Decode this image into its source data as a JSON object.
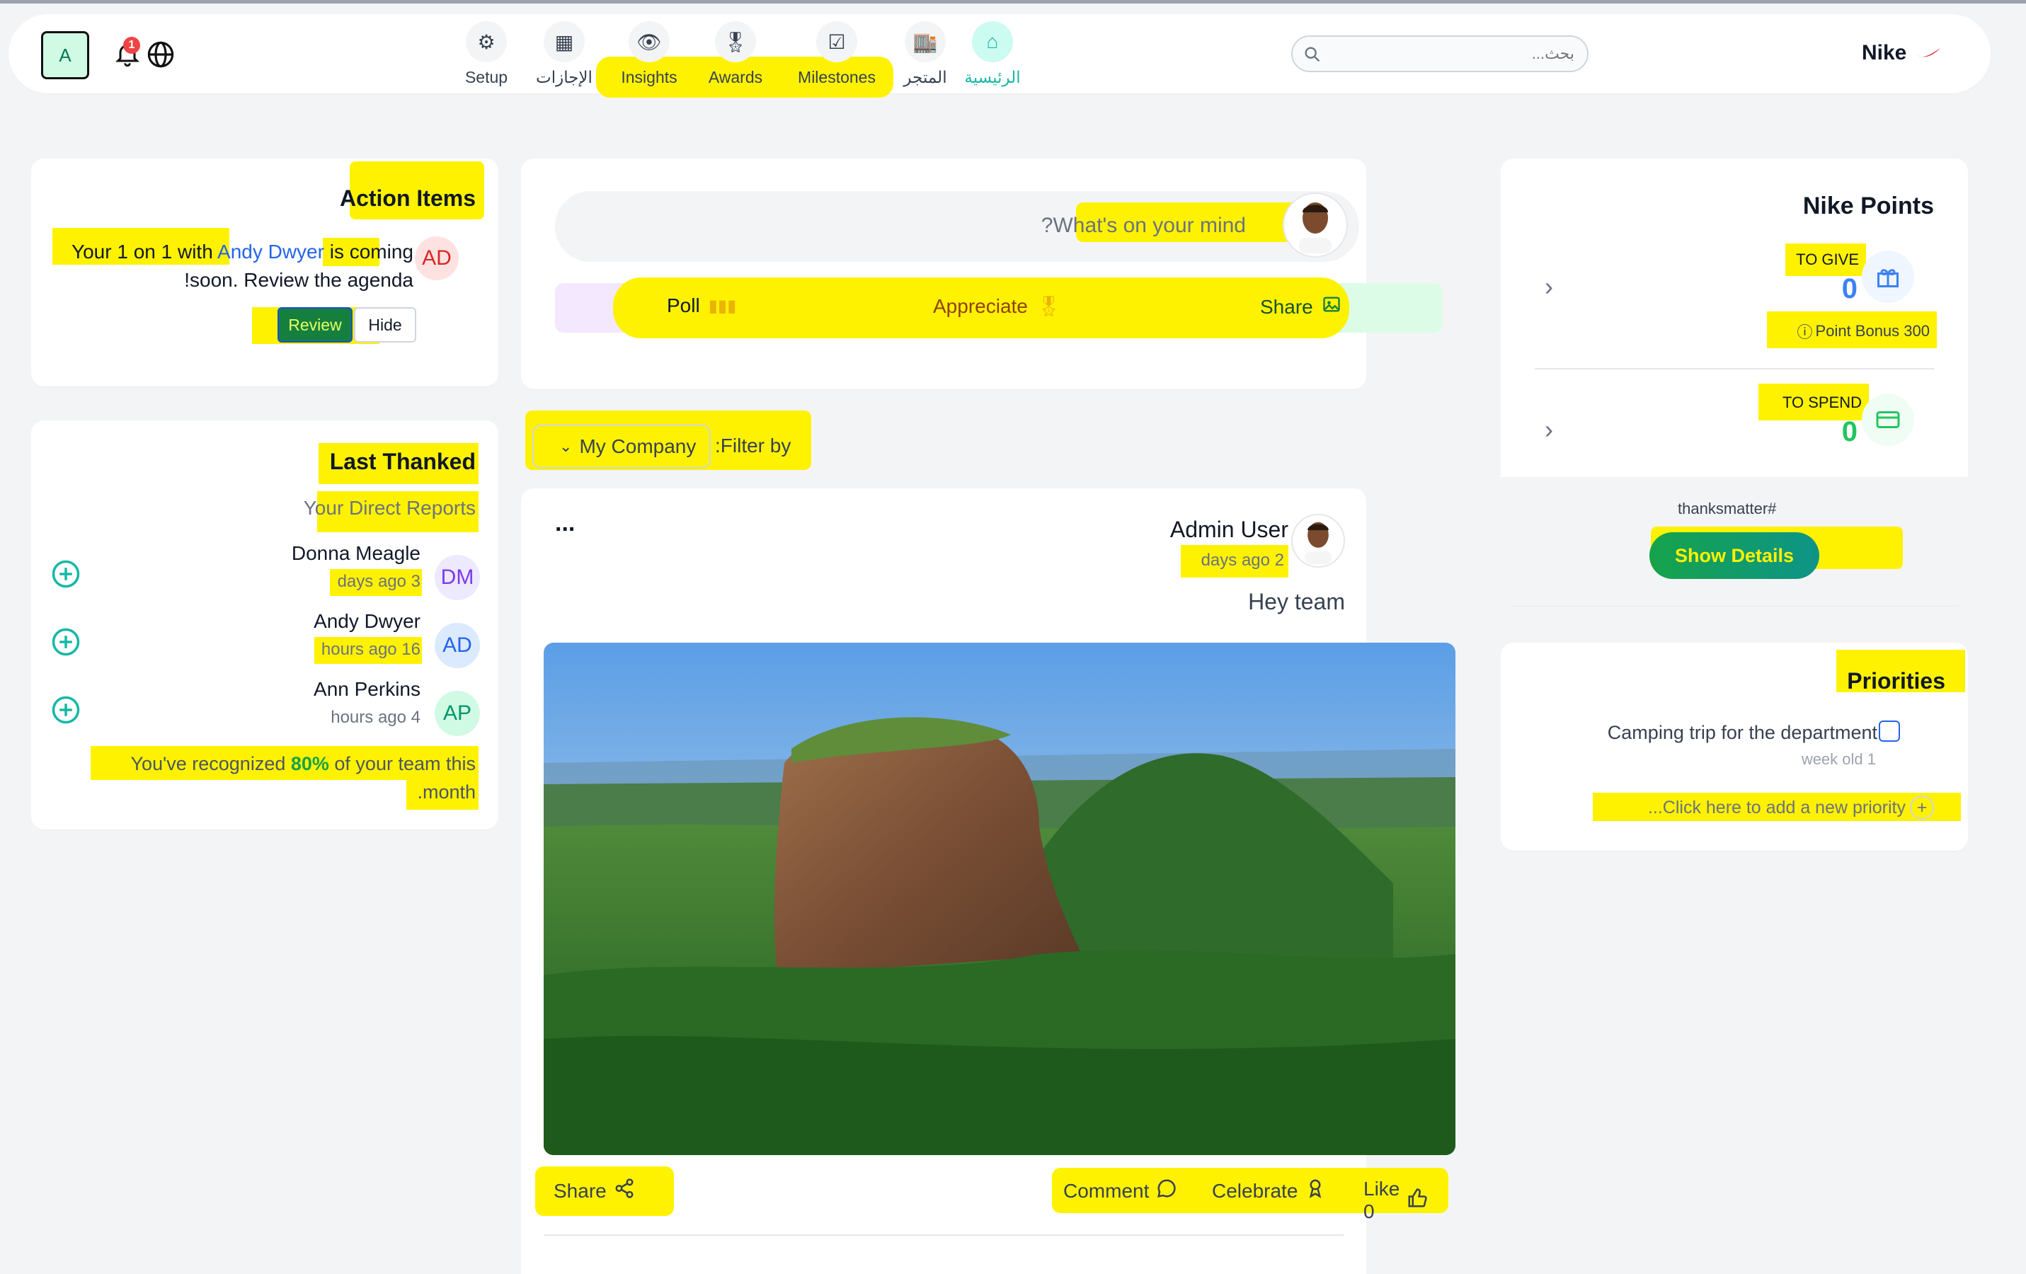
{
  "top": {
    "user_initial": "A",
    "notif_count": "1",
    "nav": [
      {
        "label": "Setup",
        "icon": "gear-icon"
      },
      {
        "label": "الإجازات",
        "icon": "calendar-icon"
      },
      {
        "label": "Insights",
        "icon": "eye-icon"
      },
      {
        "label": "Awards",
        "icon": "award-icon"
      },
      {
        "label": "Milestones",
        "icon": "checklist-icon"
      },
      {
        "label": "المتجر",
        "icon": "store-icon"
      },
      {
        "label": "الرئيسية",
        "icon": "home-icon"
      }
    ],
    "search_placeholder": "...بحث",
    "brand": "Nike"
  },
  "action_items": {
    "title": "Action Items",
    "msg_part1": "Your 1 on 1 with ",
    "msg_link": "Andy Dwyer",
    "msg_part2": " is coming",
    "msg_line2": "!soon. Review the agenda",
    "avatar": "AD",
    "review": "Review",
    "hide": "Hide"
  },
  "last_thanked": {
    "title": "Last Thanked",
    "subtitle": "Your Direct Reports",
    "people": [
      {
        "name": "Donna Meagle",
        "time": "days ago 3",
        "initials": "DM",
        "color": "#7c3aed",
        "bg": "#ede9fe"
      },
      {
        "name": "Andy Dwyer",
        "time": "hours ago 16",
        "initials": "AD",
        "color": "#2563eb",
        "bg": "#dbeafe"
      },
      {
        "name": "Ann Perkins",
        "time": "hours ago 4",
        "initials": "AP",
        "color": "#059669",
        "bg": "#d1fae5"
      }
    ],
    "recognized_a": "You've recognized ",
    "recognized_pct": "80%",
    "recognized_b": " of your team this",
    "recognized_c": ".month"
  },
  "composer": {
    "placeholder": "?What's on your mind",
    "poll": "Poll",
    "appreciate": "Appreciate",
    "share": "Share"
  },
  "filter": {
    "label": ":Filter by",
    "value": "My Company"
  },
  "post": {
    "author": "Admin User",
    "time": "days ago 2",
    "text": "Hey team",
    "menu": "...",
    "share": "Share",
    "comment": "Comment",
    "celebrate": "Celebrate",
    "like": "Like 0"
  },
  "points": {
    "title": "Nike Points",
    "to_give": "TO GIVE",
    "give_val": "0",
    "bonus": "Point Bonus 300",
    "to_spend": "TO SPEND",
    "spend_val": "0",
    "hashtag": "thanksmatter#",
    "details": "Show Details"
  },
  "priorities": {
    "title": "Priorities",
    "item": "Camping trip for the department",
    "item_time": "week old 1",
    "add": "...Click here to add a new priority"
  }
}
